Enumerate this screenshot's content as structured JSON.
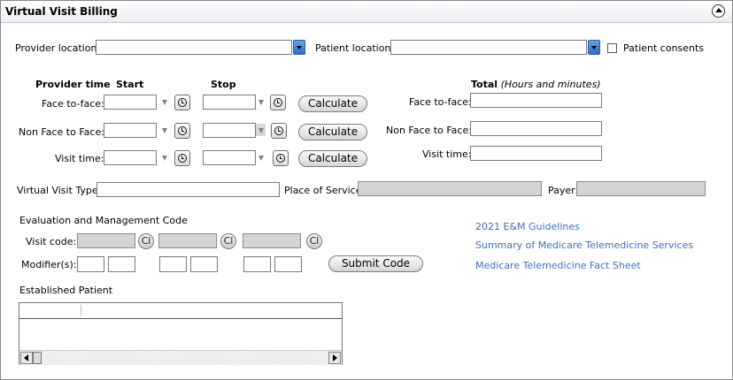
{
  "window": {
    "title": "Virtual Visit Billing"
  },
  "location": {
    "provider_label": "Provider location:",
    "provider_value": "",
    "patient_label": "Patient location:",
    "patient_value": "",
    "consent_label": "Patient consents",
    "consent_checked": false
  },
  "time": {
    "header_provider": "Provider time",
    "header_start": "Start",
    "header_stop": "Stop",
    "header_total": "Total",
    "header_total_note": "(Hours and minutes)",
    "rows": [
      {
        "label": "Face to-face:",
        "start": "",
        "stop": "",
        "calc": "Calculate",
        "total_label": "Face to-face:",
        "total": ""
      },
      {
        "label": "Non Face to Face:",
        "start": "",
        "stop": "",
        "calc": "Calculate",
        "total_label": "Non Face to Face:",
        "total": ""
      },
      {
        "label": "Visit time:",
        "start": "",
        "stop": "",
        "calc": "Calculate",
        "total_label": "Visit time:",
        "total": ""
      }
    ]
  },
  "visit": {
    "type_label": "Virtual Visit Type:",
    "type_value": "",
    "pos_label": "Place of Service:",
    "pos_value": "",
    "payer_label": "Payer:",
    "payer_value": ""
  },
  "em": {
    "section_label": "Evaluation and Management Code",
    "visit_code_label": "Visit code:",
    "modifier_label": "Modifier(s):",
    "clear_label": "Cl",
    "submit_label": "Submit Code"
  },
  "links": [
    "2021 E&M Guidelines",
    "Summary of Medicare Telemedicine Services",
    "Medicare Telemedicine Fact Sheet"
  ],
  "established": {
    "label": "Established Patient"
  }
}
